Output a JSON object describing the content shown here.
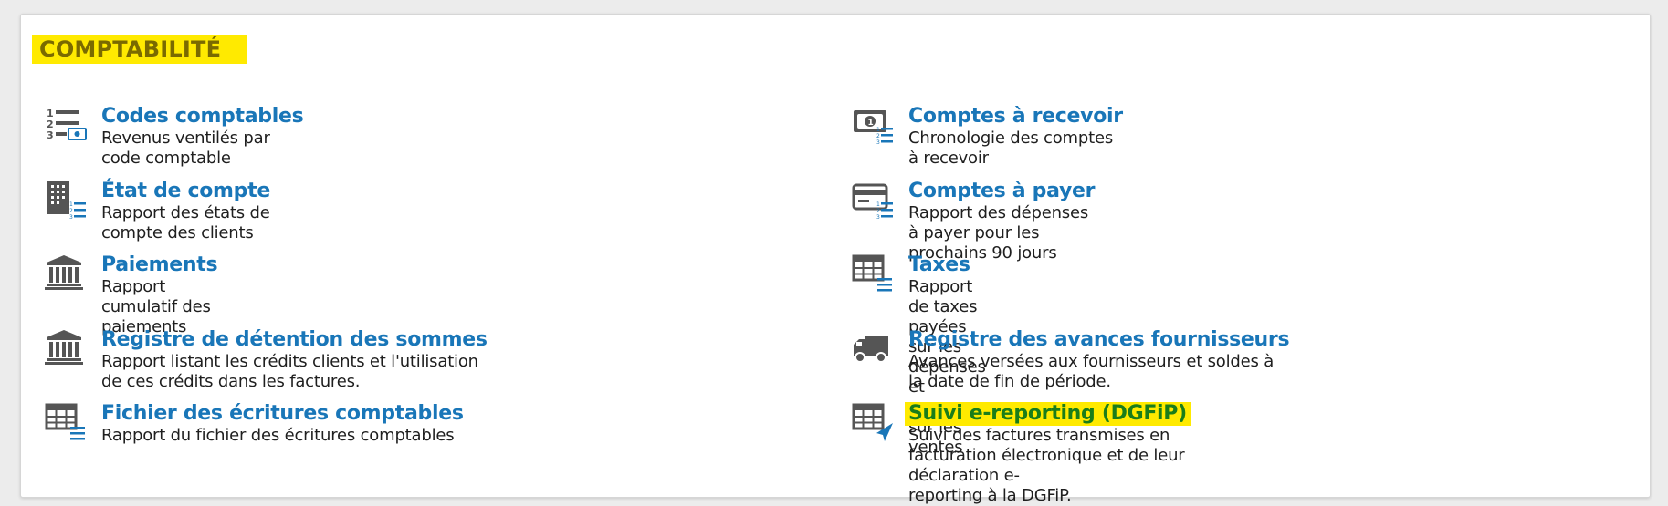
{
  "section": {
    "title": "COMPTABILITÉ"
  },
  "colors": {
    "link": "#1976b8",
    "highlight": "#ffea00",
    "icon": "#555555"
  },
  "left_items": [
    {
      "title": "Codes comptables",
      "description": "Revenus ventilés par code comptable",
      "icon": "numbered-list-money-icon"
    },
    {
      "title": "État de compte",
      "description": "Rapport des états de compte des clients",
      "icon": "building-list-icon"
    },
    {
      "title": "Paiements",
      "description": "Rapport cumulatif des paiements",
      "icon": "bank-icon"
    },
    {
      "title": "Registre de détention des sommes",
      "description": "Rapport listant les crédits clients et l'utilisation de ces crédits dans les factures.",
      "icon": "bank-icon"
    },
    {
      "title": "Fichier des écritures comptables",
      "description": "Rapport du fichier des écritures comptables",
      "icon": "table-list-icon"
    }
  ],
  "right_items": [
    {
      "title": "Comptes à recevoir",
      "description": "Chronologie des comptes à recevoir",
      "icon": "banknote-list-icon"
    },
    {
      "title": "Comptes à payer",
      "description": "Rapport des dépenses à payer pour les prochains 90 jours",
      "icon": "credit-card-list-icon"
    },
    {
      "title": "Taxes",
      "description": "Rapport de taxes payées sur les dépenses et perçues sur les ventes",
      "icon": "table-list-icon"
    },
    {
      "title": "Registre des avances fournisseurs",
      "description": "Avances versées aux fournisseurs et soldes à la date de fin de période.",
      "icon": "truck-icon"
    },
    {
      "title": "Suivi e-reporting (DGFiP)",
      "description": "Suivi des factures transmises en facturation électronique et de leur déclaration e-",
      "description_line2": "reporting à la DGFiP.",
      "icon": "table-send-icon"
    }
  ]
}
